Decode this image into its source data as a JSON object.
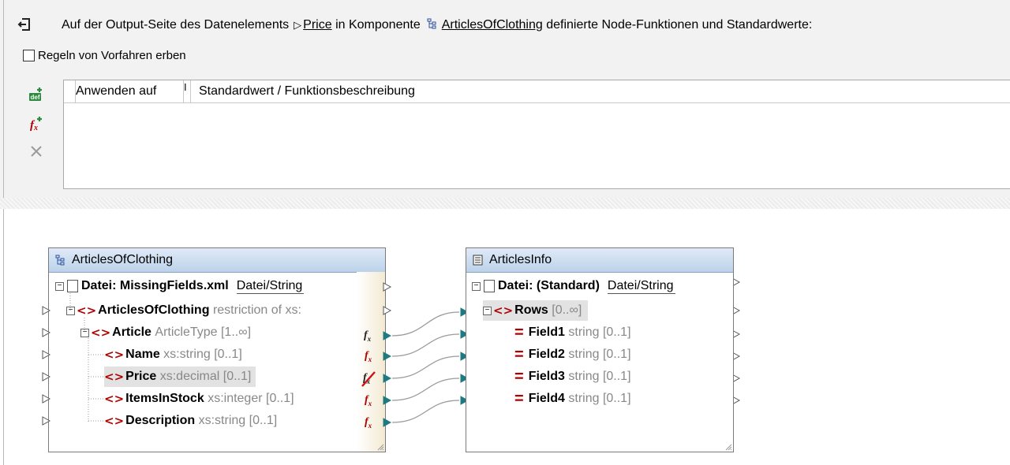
{
  "header": {
    "prefix": "Auf der Output-Seite des Datenelements",
    "item": "Price",
    "middle": "in Komponente",
    "component": "ArticlesOfClothing",
    "suffix": "definierte Node-Funktionen und Standardwerte:"
  },
  "inherit_label": "Regeln von Vorfahren erben",
  "grid": {
    "col1": "Anwenden auf",
    "col2": "I",
    "col3": "Standardwert / Funktionsbeschreibung"
  },
  "toolbar": {
    "add_default": "def",
    "add_function": "fx",
    "delete": "×"
  },
  "source": {
    "title": "ArticlesOfClothing",
    "file_label": "Datei: MissingFields.xml",
    "file_mode": "Datei/String",
    "rows": [
      {
        "name": "ArticlesOfClothing",
        "type": "restriction of xs:"
      },
      {
        "name": "Article",
        "type": "ArticleType [1..∞]"
      },
      {
        "name": "Name",
        "type": "xs:string [0..1]"
      },
      {
        "name": "Price",
        "type": "xs:decimal [0..1]"
      },
      {
        "name": "ItemsInStock",
        "type": "xs:integer [0..1]"
      },
      {
        "name": "Description",
        "type": "xs:string [0..1]"
      }
    ]
  },
  "target": {
    "title": "ArticlesInfo",
    "file_label": "Datei: (Standard)",
    "file_mode": "Datei/String",
    "rows": [
      {
        "name": "Rows",
        "type": "[0..∞]"
      },
      {
        "name": "Field1",
        "type": "string [0..1]"
      },
      {
        "name": "Field2",
        "type": "string [0..1]"
      },
      {
        "name": "Field3",
        "type": "string [0..1]"
      },
      {
        "name": "Field4",
        "type": "string [0..1]"
      }
    ]
  },
  "colors": {
    "tag": "#b00000",
    "connector": "#1f7a80",
    "title_bar": "#c9dbee"
  }
}
